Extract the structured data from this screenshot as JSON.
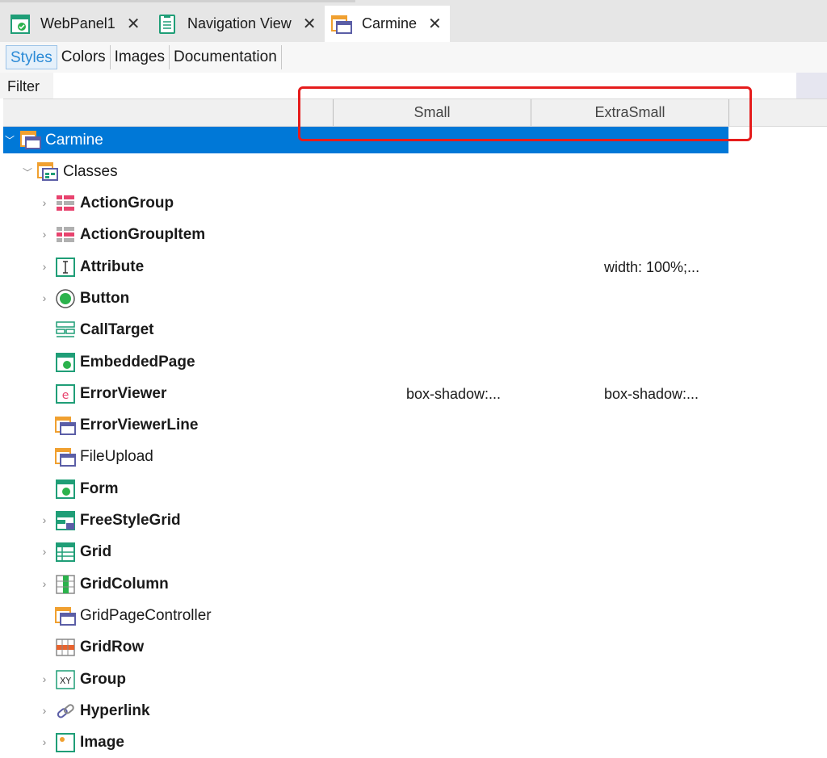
{
  "tabs": [
    {
      "label": "WebPanel1",
      "icon": "webpanel-icon",
      "active": false
    },
    {
      "label": "Navigation View",
      "icon": "navigation-view-icon",
      "active": false
    },
    {
      "label": "Carmine",
      "icon": "theme-icon",
      "active": true
    }
  ],
  "close_glyph": "✕",
  "sub_tabs": [
    "Styles",
    "Colors",
    "Images",
    "Documentation"
  ],
  "filter": {
    "label": "Filter",
    "value": ""
  },
  "columns": [
    "Small",
    "ExtraSmall"
  ],
  "tree": {
    "root": {
      "label": "Carmine",
      "expander": "﹀"
    },
    "classes": {
      "label": "Classes",
      "expander": "﹀"
    },
    "items": [
      {
        "label": "ActionGroup",
        "icon": "action-group-icon",
        "expandable": true,
        "small": "",
        "extra_small": ""
      },
      {
        "label": "ActionGroupItem",
        "icon": "action-group-item-icon",
        "expandable": true,
        "small": "",
        "extra_small": ""
      },
      {
        "label": "Attribute",
        "icon": "attribute-icon",
        "expandable": true,
        "small": "",
        "extra_small": "width:  100%;..."
      },
      {
        "label": "Button",
        "icon": "button-icon",
        "expandable": true,
        "small": "",
        "extra_small": ""
      },
      {
        "label": "CallTarget",
        "icon": "call-target-icon",
        "expandable": false,
        "small": "",
        "extra_small": ""
      },
      {
        "label": "EmbeddedPage",
        "icon": "embedded-page-icon",
        "expandable": false,
        "small": "",
        "extra_small": ""
      },
      {
        "label": "ErrorViewer",
        "icon": "error-viewer-icon",
        "expandable": false,
        "small": "box-shadow:...",
        "extra_small": "box-shadow:..."
      },
      {
        "label": "ErrorViewerLine",
        "icon": "class-icon",
        "expandable": false,
        "small": "",
        "extra_small": ""
      },
      {
        "label": "FileUpload",
        "icon": "class-icon",
        "expandable": false,
        "small": "",
        "extra_small": ""
      },
      {
        "label": "Form",
        "icon": "form-icon",
        "expandable": false,
        "small": "",
        "extra_small": ""
      },
      {
        "label": "FreeStyleGrid",
        "icon": "free-style-grid-icon",
        "expandable": true,
        "small": "",
        "extra_small": ""
      },
      {
        "label": "Grid",
        "icon": "grid-icon",
        "expandable": true,
        "small": "",
        "extra_small": ""
      },
      {
        "label": "GridColumn",
        "icon": "grid-column-icon",
        "expandable": true,
        "small": "",
        "extra_small": ""
      },
      {
        "label": "GridPageController",
        "icon": "class-icon",
        "expandable": false,
        "small": "",
        "extra_small": ""
      },
      {
        "label": "GridRow",
        "icon": "grid-row-icon",
        "expandable": false,
        "small": "",
        "extra_small": ""
      },
      {
        "label": "Group",
        "icon": "group-icon",
        "expandable": true,
        "small": "",
        "extra_small": ""
      },
      {
        "label": "Hyperlink",
        "icon": "hyperlink-icon",
        "expandable": true,
        "small": "",
        "extra_small": ""
      },
      {
        "label": "Image",
        "icon": "image-icon",
        "expandable": true,
        "small": "",
        "extra_small": ""
      }
    ]
  },
  "colors": {
    "selection": "#0078d7",
    "active_tab_text": "#2b8ad6",
    "highlight": "#e51c1c"
  }
}
